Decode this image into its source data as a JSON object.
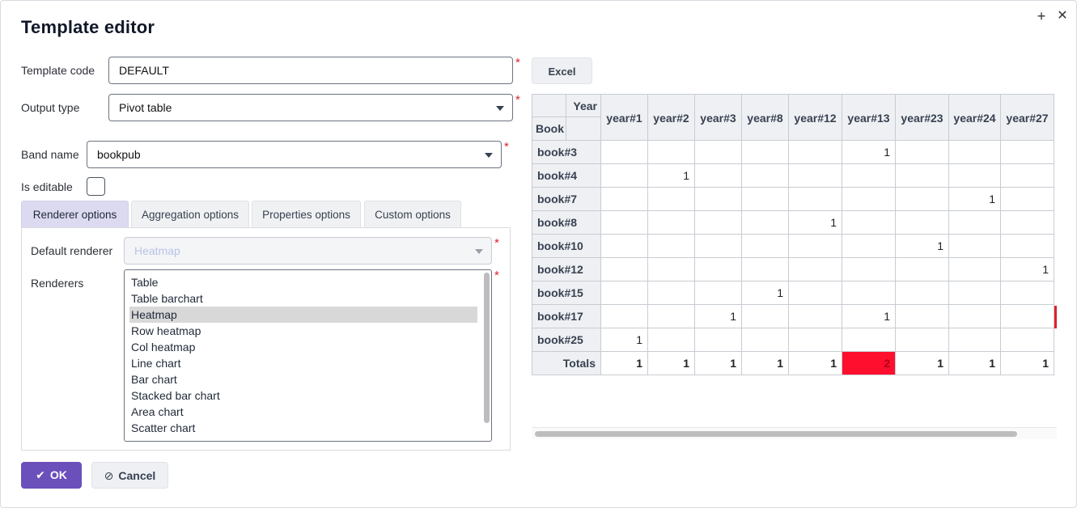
{
  "dialog": {
    "title": "Template editor",
    "maximize_glyph": "+",
    "close_glyph": "✕"
  },
  "form": {
    "template_code_label": "Template code",
    "template_code_value": "DEFAULT",
    "output_type_label": "Output type",
    "output_type_value": "Pivot table",
    "band_name_label": "Band name",
    "band_name_value": "bookpub",
    "is_editable_label": "Is editable",
    "is_editable_checked": false,
    "required_mark": "*"
  },
  "tabs": [
    {
      "label": "Renderer options",
      "active": true
    },
    {
      "label": "Aggregation options",
      "active": false
    },
    {
      "label": "Properties options",
      "active": false
    },
    {
      "label": "Custom options",
      "active": false
    }
  ],
  "renderer": {
    "default_label": "Default renderer",
    "default_value": "Heatmap",
    "renderers_label": "Renderers",
    "items": [
      "Table",
      "Table barchart",
      "Heatmap",
      "Row heatmap",
      "Col heatmap",
      "Line chart",
      "Bar chart",
      "Stacked bar chart",
      "Area chart",
      "Scatter chart"
    ],
    "selected": "Heatmap"
  },
  "buttons": {
    "ok": "OK",
    "cancel": "Cancel",
    "excel": "Excel"
  },
  "pivot": {
    "col_attr": "Year",
    "row_attr": "Book",
    "columns": [
      "year#1",
      "year#2",
      "year#3",
      "year#8",
      "year#12",
      "year#13",
      "year#23",
      "year#24",
      "year#27"
    ],
    "rows": [
      {
        "label": "book#3",
        "values": [
          "",
          "",
          "",
          "",
          "",
          "1",
          "",
          "",
          ""
        ]
      },
      {
        "label": "book#4",
        "values": [
          "",
          "1",
          "",
          "",
          "",
          "",
          "",
          "",
          ""
        ]
      },
      {
        "label": "book#7",
        "values": [
          "",
          "",
          "",
          "",
          "",
          "",
          "",
          "1",
          ""
        ]
      },
      {
        "label": "book#8",
        "values": [
          "",
          "",
          "",
          "",
          "1",
          "",
          "",
          "",
          ""
        ]
      },
      {
        "label": "book#10",
        "values": [
          "",
          "",
          "",
          "",
          "",
          "",
          "1",
          "",
          ""
        ]
      },
      {
        "label": "book#12",
        "values": [
          "",
          "",
          "",
          "",
          "",
          "",
          "",
          "",
          "1"
        ]
      },
      {
        "label": "book#15",
        "values": [
          "",
          "",
          "",
          "1",
          "",
          "",
          "",
          "",
          ""
        ]
      },
      {
        "label": "book#17",
        "values": [
          "",
          "",
          "1",
          "",
          "",
          "1",
          "",
          "",
          ""
        ]
      },
      {
        "label": "book#25",
        "values": [
          "1",
          "",
          "",
          "",
          "",
          "",
          "",
          "",
          ""
        ]
      }
    ],
    "totals_label": "Totals",
    "totals": [
      "1",
      "1",
      "1",
      "1",
      "1",
      "2",
      "1",
      "1",
      "1"
    ],
    "heat_color": "#ff0f2e",
    "edge_marker_color": "#e0202b"
  }
}
